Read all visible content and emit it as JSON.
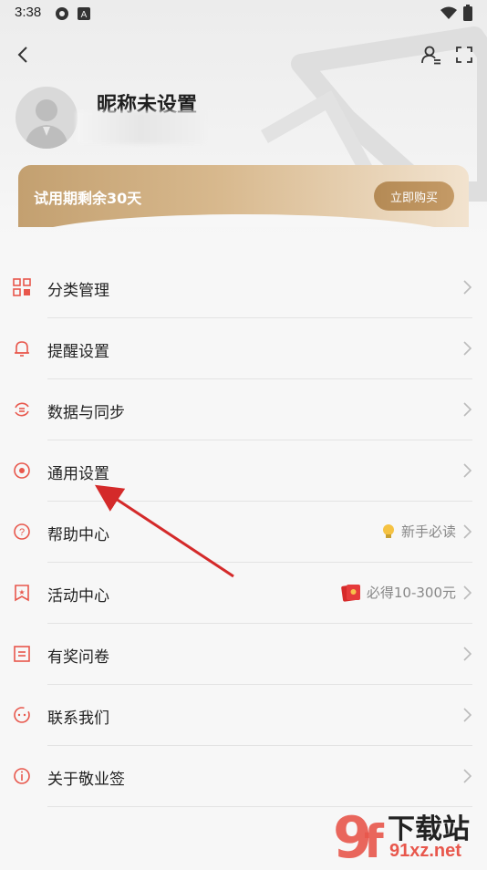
{
  "status": {
    "time": "3:38"
  },
  "profile": {
    "nickname": "昵称未设置"
  },
  "trial": {
    "text": "试用期剩余30天",
    "button": "立即购买"
  },
  "menu": [
    {
      "label": "分类管理",
      "icon": "grid-icon"
    },
    {
      "label": "提醒设置",
      "icon": "bell-icon"
    },
    {
      "label": "数据与同步",
      "icon": "sync-icon"
    },
    {
      "label": "通用设置",
      "icon": "settings-dot-icon"
    },
    {
      "label": "帮助中心",
      "icon": "help-icon",
      "extra": "新手必读",
      "extra_icon": "lightbulb-icon"
    },
    {
      "label": "活动中心",
      "icon": "star-flag-icon",
      "extra": "必得10-300元",
      "extra_icon": "red-envelope-icon"
    },
    {
      "label": "有奖问卷",
      "icon": "list-icon"
    },
    {
      "label": "联系我们",
      "icon": "chat-icon"
    },
    {
      "label": "关于敬业签",
      "icon": "info-icon"
    }
  ],
  "watermark": {
    "title": "下载站",
    "url": "91xz.net"
  },
  "colors": {
    "accent": "#e8574c",
    "gold": "#c49a66"
  }
}
